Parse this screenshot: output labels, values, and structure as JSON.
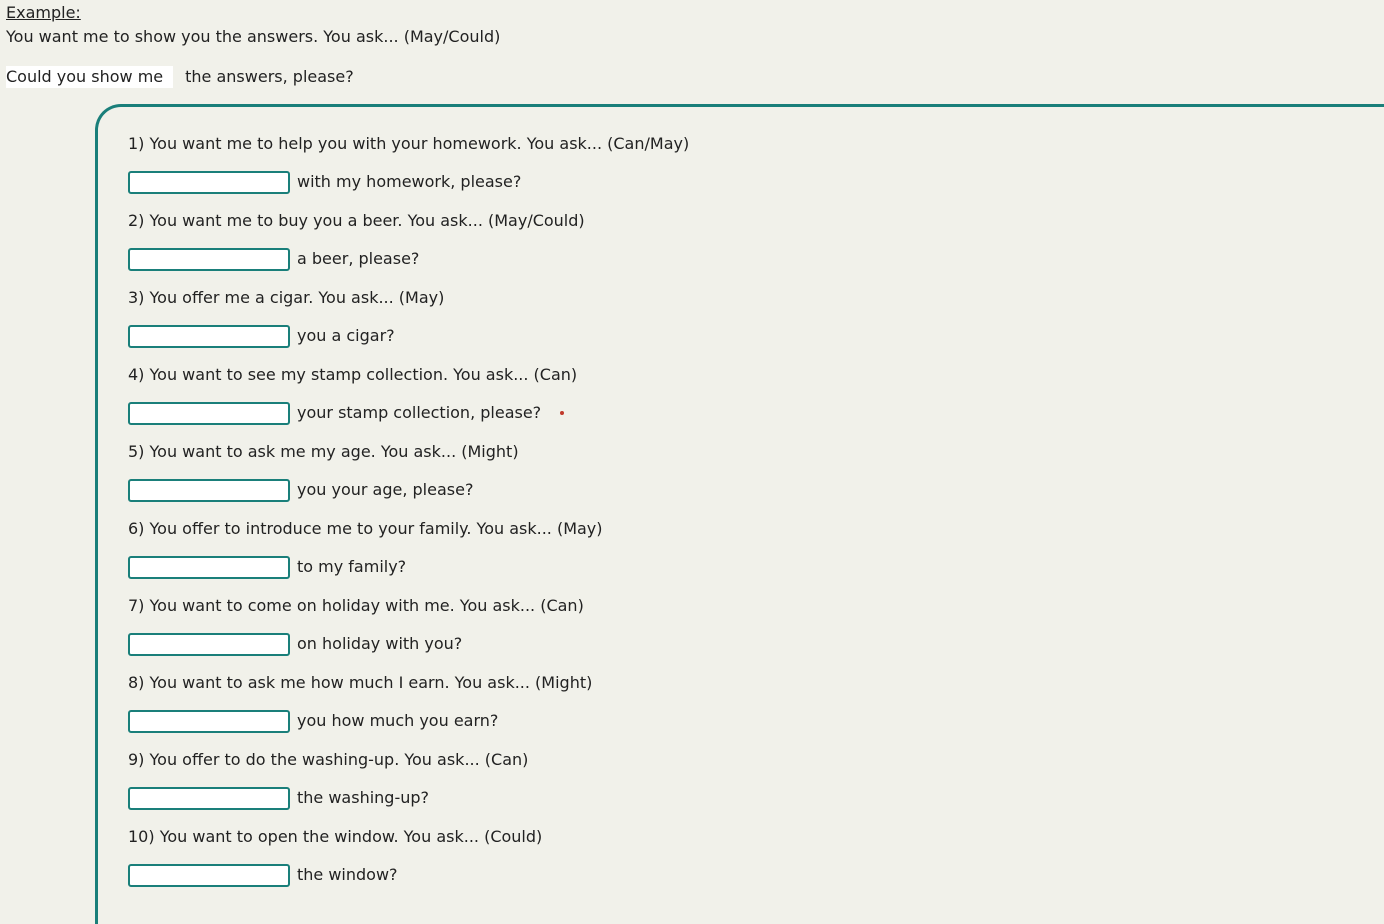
{
  "example": {
    "heading": "Example:",
    "prompt": "You want me to show you the answers. You ask... (May/Could)",
    "filled_answer": "Could you show me",
    "completion": "the answers, please?"
  },
  "questions": [
    {
      "prompt": "1) You want me to help you with your homework. You ask... (Can/May)",
      "completion": "with my homework, please?",
      "value": ""
    },
    {
      "prompt": "2) You want me to buy you a beer. You ask... (May/Could)",
      "completion": "a beer, please?",
      "value": ""
    },
    {
      "prompt": "3) You offer me a cigar. You ask... (May)",
      "completion": "you a cigar?",
      "value": ""
    },
    {
      "prompt": "4) You want to see my stamp collection. You ask... (Can)",
      "completion": "your stamp collection, please?",
      "value": ""
    },
    {
      "prompt": "5) You want to ask me my age. You ask...  (Might)",
      "completion": "you your age, please?",
      "value": ""
    },
    {
      "prompt": "6) You offer to introduce me to your family. You ask... (May)",
      "completion": "to my family?",
      "value": ""
    },
    {
      "prompt": "7) You want to come on holiday with me. You ask... (Can)",
      "completion": "on holiday with you?",
      "value": ""
    },
    {
      "prompt": "8) You want to ask me how much I earn. You ask... (Might)",
      "completion": "you how much you earn?",
      "value": ""
    },
    {
      "prompt": "9) You offer to do the washing-up. You ask... (Can)",
      "completion": "the washing-up?",
      "value": ""
    },
    {
      "prompt": "10) You want to open the window. You ask... (Could)",
      "completion": "the window?",
      "value": ""
    }
  ],
  "colors": {
    "accent": "#1a7f7a",
    "background": "#f1f1ea",
    "marker": "#c0392b"
  }
}
